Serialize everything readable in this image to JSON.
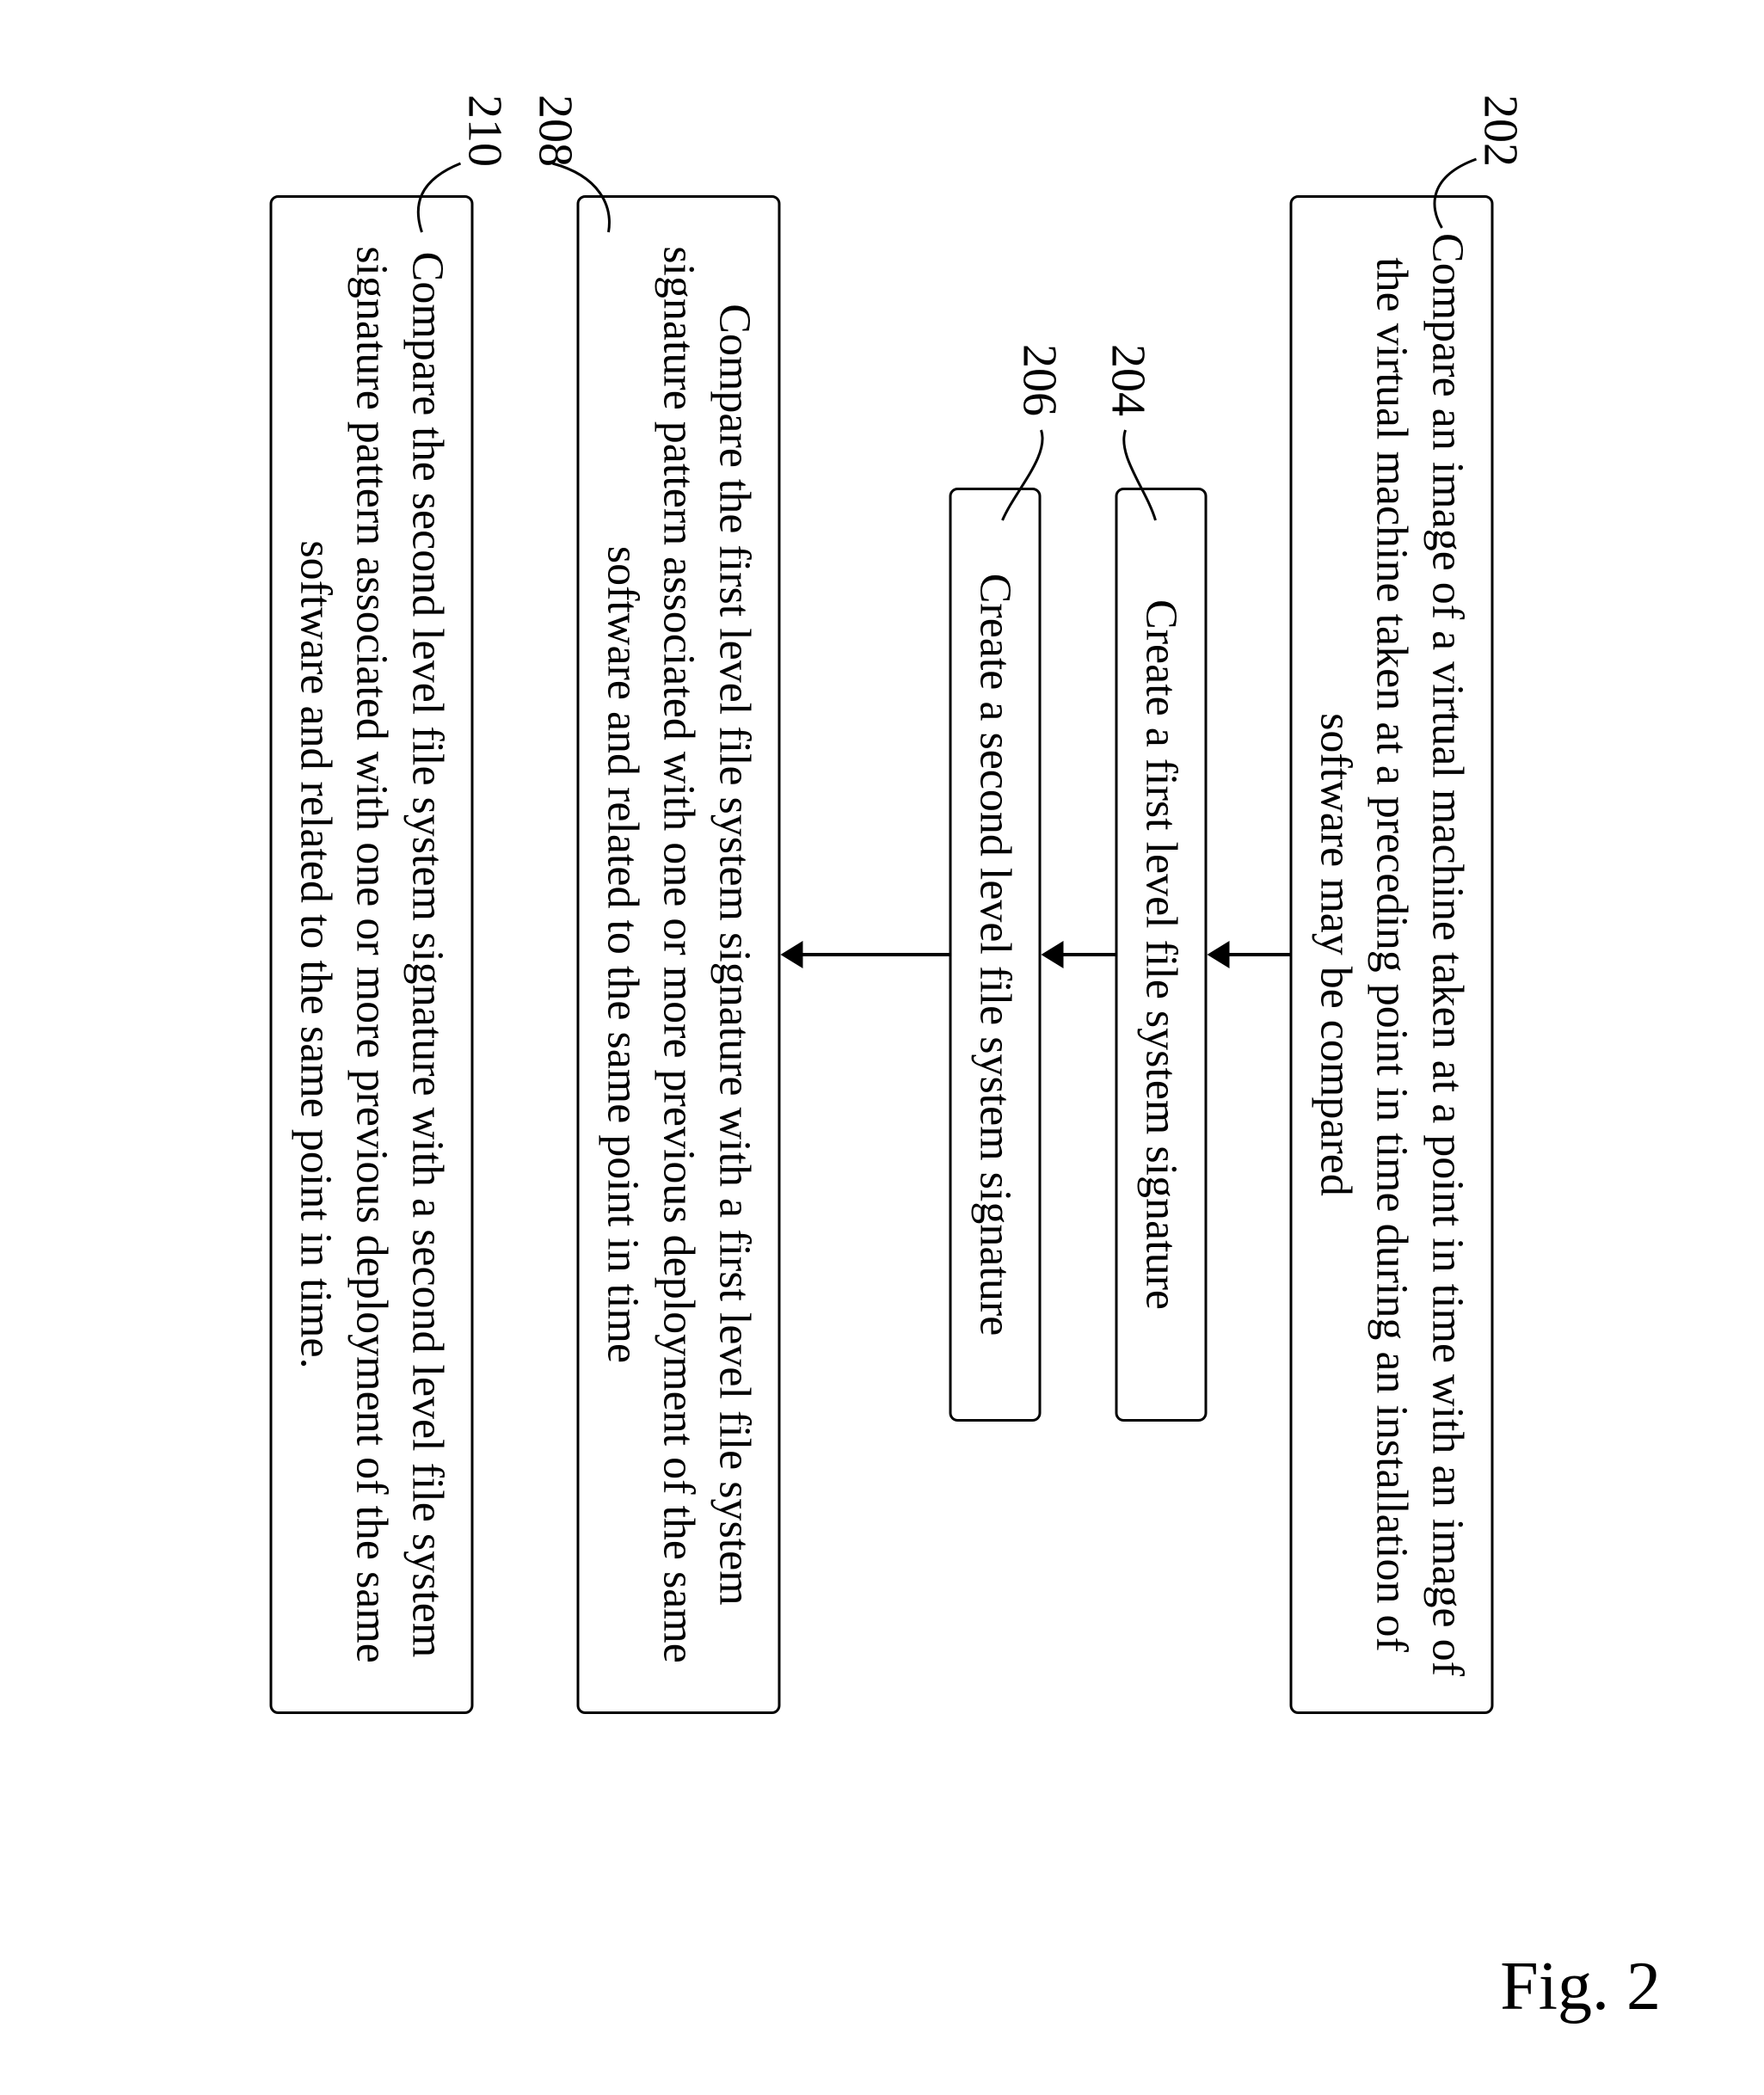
{
  "flow": {
    "steps": [
      {
        "ref": "202",
        "text": "Compare an image of a virtual machine taken at a point in time with an image of the virtual machine taken at a preceding point in time during an installation of software may be compared"
      },
      {
        "ref": "204",
        "text": "Create a first level file system signature"
      },
      {
        "ref": "206",
        "text": "Create a second level file system signature"
      },
      {
        "ref": "208",
        "text": "Compare the first level file system signature with a first level file system signature pattern associated with one or more previous deployment of the same software and related to the same point in time"
      },
      {
        "ref": "210",
        "text": "Compare the second level file system signature with a second level file system signature pattern associated with one or more previous deployment of the same software and related to the same point in time."
      }
    ]
  },
  "figure_label": "Fig. 2"
}
